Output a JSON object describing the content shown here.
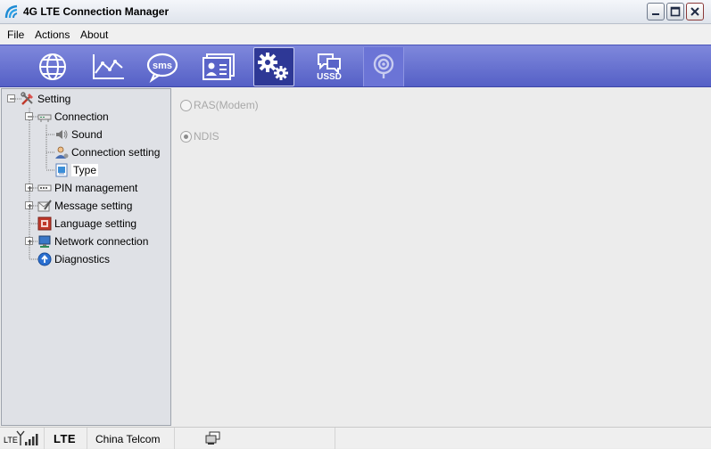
{
  "window": {
    "title": "4G LTE Connection Manager"
  },
  "menu": {
    "items": [
      "File",
      "Actions",
      "About"
    ]
  },
  "toolbar": {
    "buttons": [
      {
        "icon": "globe-icon"
      },
      {
        "icon": "chart-icon"
      },
      {
        "icon": "sms-icon",
        "label": "sms"
      },
      {
        "icon": "contacts-icon"
      },
      {
        "icon": "settings-gears-icon",
        "active": true
      },
      {
        "icon": "ussd-icon",
        "label": "USSD"
      },
      {
        "icon": "update-icon"
      }
    ]
  },
  "tree": {
    "root": "Setting",
    "items": [
      {
        "label": "Connection",
        "expanded": true
      },
      {
        "label": "Sound"
      },
      {
        "label": "Connection setting"
      },
      {
        "label": "Type",
        "selected": true
      },
      {
        "label": "PIN management"
      },
      {
        "label": "Message setting"
      },
      {
        "label": "Language setting"
      },
      {
        "label": "Network connection"
      },
      {
        "label": "Diagnostics"
      }
    ]
  },
  "type_panel": {
    "options": [
      {
        "label": "RAS(Modem)",
        "checked": false,
        "enabled": false
      },
      {
        "label": "NDIS",
        "checked": true,
        "enabled": false
      }
    ]
  },
  "status": {
    "signal_label": "LTE",
    "network_type": "LTE",
    "operator": "China Telcom"
  },
  "colors": {
    "toolbar": "#5a64c8",
    "toolbar_active": "#2e3896",
    "tree_bg": "#dfe1e6"
  }
}
